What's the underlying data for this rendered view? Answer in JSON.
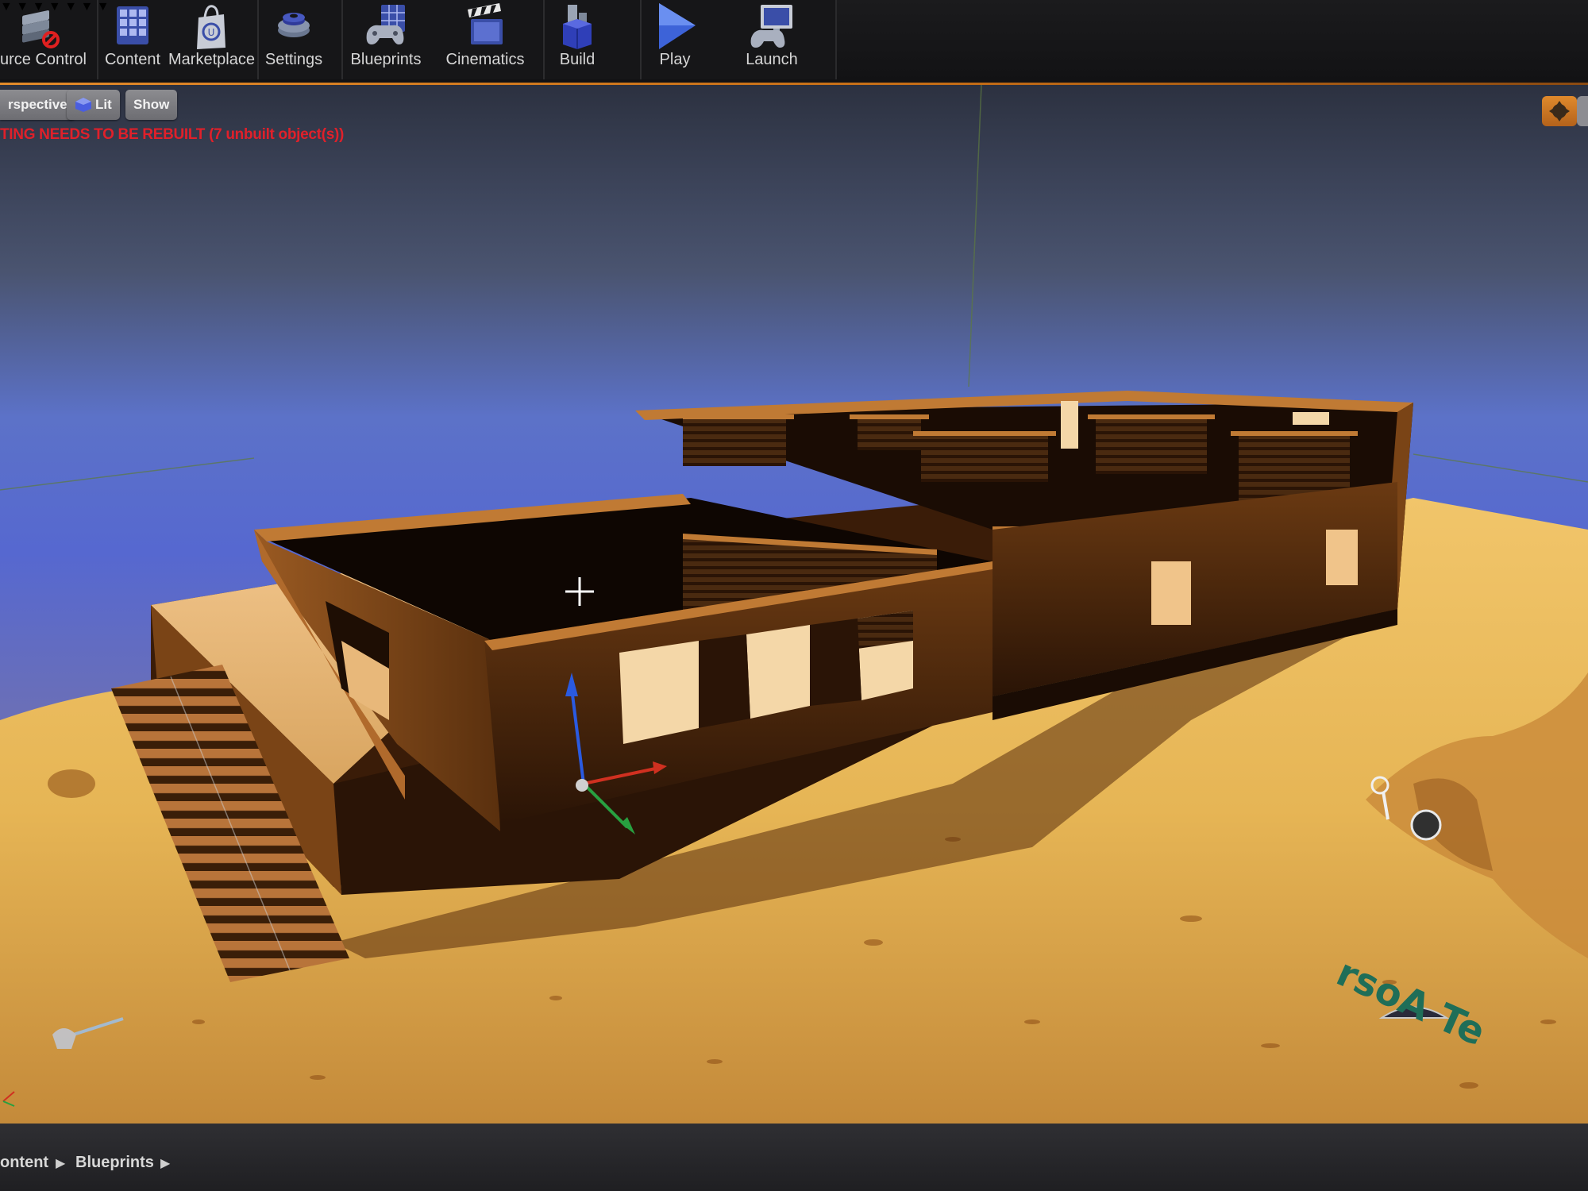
{
  "toolbar": {
    "items": [
      {
        "label": "urce Control",
        "icon": "source-control-icon",
        "has_dropdown": true
      },
      {
        "label": "Content",
        "icon": "content-icon",
        "has_dropdown": false
      },
      {
        "label": "Marketplace",
        "icon": "marketplace-icon",
        "has_dropdown": false
      },
      {
        "label": "Settings",
        "icon": "gear-icon",
        "has_dropdown": true
      },
      {
        "label": "Blueprints",
        "icon": "blueprints-icon",
        "has_dropdown": true
      },
      {
        "label": "Cinematics",
        "icon": "clapperboard-icon",
        "has_dropdown": true
      },
      {
        "label": "Build",
        "icon": "build-icon",
        "has_dropdown": true
      },
      {
        "label": "Play",
        "icon": "play-icon",
        "has_dropdown": true
      },
      {
        "label": "Launch",
        "icon": "launch-icon",
        "has_dropdown": true
      }
    ],
    "dropdown_glyph": "▼"
  },
  "viewport": {
    "perspective_label": "rspective",
    "lit_label": "Lit",
    "show_label": "Show",
    "warning": "TING NEEDS TO BE REBUILT (7 unbuilt object(s))",
    "overlay_text": "rsoA Te",
    "accent_color": "#e28a2a",
    "warning_color": "#e0202a"
  },
  "breadcrumb": {
    "items": [
      "ontent",
      "Blueprints"
    ],
    "separator": "▶"
  }
}
